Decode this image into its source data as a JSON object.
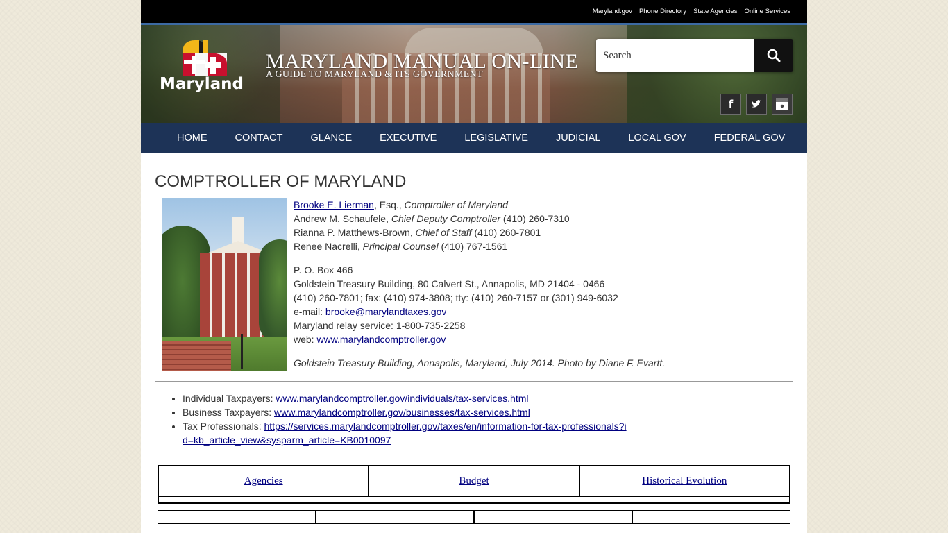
{
  "topbar": {
    "links": [
      "Maryland.gov",
      "Phone Directory",
      "State Agencies",
      "Online Services"
    ]
  },
  "header": {
    "logo_text": "Maryland",
    "site_title": "MARYLAND MANUAL ON-LINE",
    "site_subtitle": "A GUIDE TO MARYLAND & ITS GOVERNMENT",
    "search_placeholder": "Search",
    "social": [
      "facebook-icon",
      "twitter-icon",
      "instagram-icon"
    ]
  },
  "nav": [
    "HOME",
    "CONTACT",
    "GLANCE",
    "EXECUTIVE",
    "LEGISLATIVE",
    "JUDICIAL",
    "LOCAL GOV",
    "FEDERAL GOV"
  ],
  "page_title": "COMPTROLLER OF MARYLAND",
  "officials": [
    {
      "name": "Brooke E. Lierman",
      "suffix": ", Esq., ",
      "title": "Comptroller of Maryland",
      "phone": ""
    },
    {
      "name": "Andrew M. Schaufele",
      "suffix": ", ",
      "title": "Chief Deputy Comptroller",
      "phone": " (410) 260-7310"
    },
    {
      "name": "Rianna P. Matthews-Brown",
      "suffix": ", ",
      "title": "Chief of Staff",
      "phone": " (410) 260-7801"
    },
    {
      "name": "Renee Nacrelli",
      "suffix": ", ",
      "title": "Principal Counsel",
      "phone": " (410) 767-1561"
    }
  ],
  "address": {
    "po_box": "P. O. Box 466",
    "street": "Goldstein Treasury Building, 80 Calvert St., Annapolis, MD 21404 - 0466",
    "phones": "(410) 260-7801; fax: (410) 974-3808; tty: (410) 260-7157 or (301) 949-6032",
    "email_label": "e-mail: ",
    "email": "brooke@marylandtaxes.gov",
    "relay": "Maryland relay service: 1-800-735-2258",
    "web_label": "web: ",
    "web": "www.marylandcomptroller.gov"
  },
  "photo_caption": "Goldstein Treasury Building, Annapolis, Maryland, July 2014. Photo by Diane F. Evartt.",
  "taxpayer_links": [
    {
      "label": "Individual Taxpayers: ",
      "url": "www.marylandcomptroller.gov/individuals/tax-services.html"
    },
    {
      "label": "Business Taxpayers: ",
      "url": "www.marylandcomptroller.gov/businesses/tax-services.html"
    },
    {
      "label": "Tax Professionals: ",
      "url": "https://services.marylandcomptroller.gov/taxes/en/information-for-tax-professionals?id=kb_article_view&sysparm_article=KB0010097"
    }
  ],
  "bottom_nav": [
    "Agencies",
    "Budget",
    "Historical Evolution"
  ],
  "colors": {
    "nav_bg": "#1d3357",
    "accent_rule": "#3c6aa3",
    "link": "#000080"
  }
}
